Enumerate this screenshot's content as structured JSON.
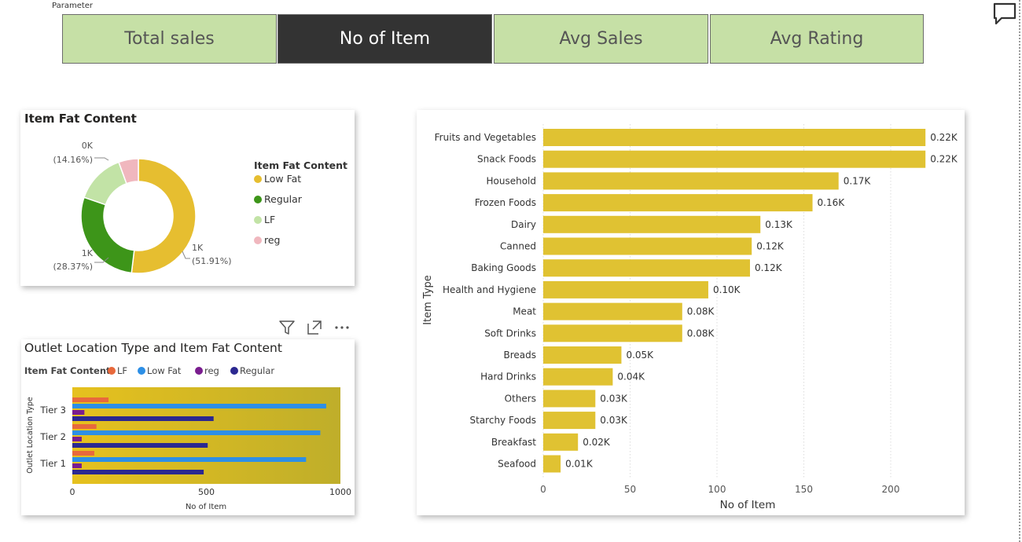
{
  "parameter": {
    "label": "Parameter",
    "buttons": [
      "Total sales",
      "No of Item",
      "Avg Sales",
      "Avg Rating"
    ],
    "active_index": 1
  },
  "header_icons": [
    "comment-icon"
  ],
  "visual_header_icons": [
    "filter-icon",
    "focus-mode-icon",
    "more-options-icon"
  ],
  "colors": {
    "param_bg": "#c6e0a6",
    "param_active_bg": "#333333",
    "bar_gold": "#e0c232",
    "low_fat": "#e6be30",
    "regular": "#3d9519",
    "lf_pie": "#c2e3a6",
    "reg_pie": "#f0b7be",
    "lf_bar": "#e8693c",
    "low_fat_bar": "#2d8fe6",
    "reg_bar": "#7a1d8f",
    "regular_bar": "#2b2890"
  },
  "chart_data": [
    {
      "type": "pie",
      "title": "Item Fat Content",
      "legend_title": "Item Fat Content",
      "legend_position": "right",
      "categories": [
        "Low Fat",
        "Regular",
        "LF",
        "reg"
      ],
      "values": [
        0.5191,
        0.2837,
        0.1416,
        0.0556
      ],
      "data_labels": [
        {
          "value": "1K",
          "pct": "(51.91%)"
        },
        {
          "value": "1K",
          "pct": "(28.37%)"
        },
        {
          "value": "0K",
          "pct": "(14.16%)"
        }
      ]
    },
    {
      "type": "bar",
      "orientation": "horizontal",
      "title": "Outlet Location Type and Item Fat Content",
      "legend_title": "Item Fat Content",
      "legend_position": "top-left",
      "categories": [
        "Tier 3",
        "Tier 2",
        "Tier 1"
      ],
      "series": [
        {
          "name": "LF",
          "values": [
            135,
            90,
            82
          ]
        },
        {
          "name": "Low Fat",
          "values": [
            947,
            925,
            872
          ]
        },
        {
          "name": "reg",
          "values": [
            45,
            35,
            35
          ]
        },
        {
          "name": "Regular",
          "values": [
            527,
            505,
            490
          ]
        }
      ],
      "xlabel": "No of Item",
      "ylabel": "Outlet Location Type",
      "xlim": [
        0,
        1000
      ],
      "xticks": [
        "0",
        "500",
        "1000"
      ]
    },
    {
      "type": "bar",
      "orientation": "horizontal",
      "categories": [
        "Fruits and Vegetables",
        "Snack Foods",
        "Household",
        "Frozen Foods",
        "Dairy",
        "Canned",
        "Baking Goods",
        "Health and Hygiene",
        "Meat",
        "Soft Drinks",
        "Breads",
        "Hard Drinks",
        "Others",
        "Starchy Foods",
        "Breakfast",
        "Seafood"
      ],
      "values": [
        220,
        220,
        170,
        155,
        125,
        120,
        119,
        95,
        80,
        80,
        45,
        40,
        30,
        30,
        20,
        10
      ],
      "data_labels": [
        "0.22K",
        "0.22K",
        "0.17K",
        "0.16K",
        "0.13K",
        "0.12K",
        "0.12K",
        "0.10K",
        "0.08K",
        "0.08K",
        "0.05K",
        "0.04K",
        "0.03K",
        "0.03K",
        "0.02K",
        "0.01K"
      ],
      "xlabel": "No of Item",
      "ylabel": "Item Type",
      "xlim": [
        0,
        220
      ],
      "xticks": [
        "0",
        "50",
        "100",
        "150",
        "200"
      ],
      "grid": true
    }
  ]
}
